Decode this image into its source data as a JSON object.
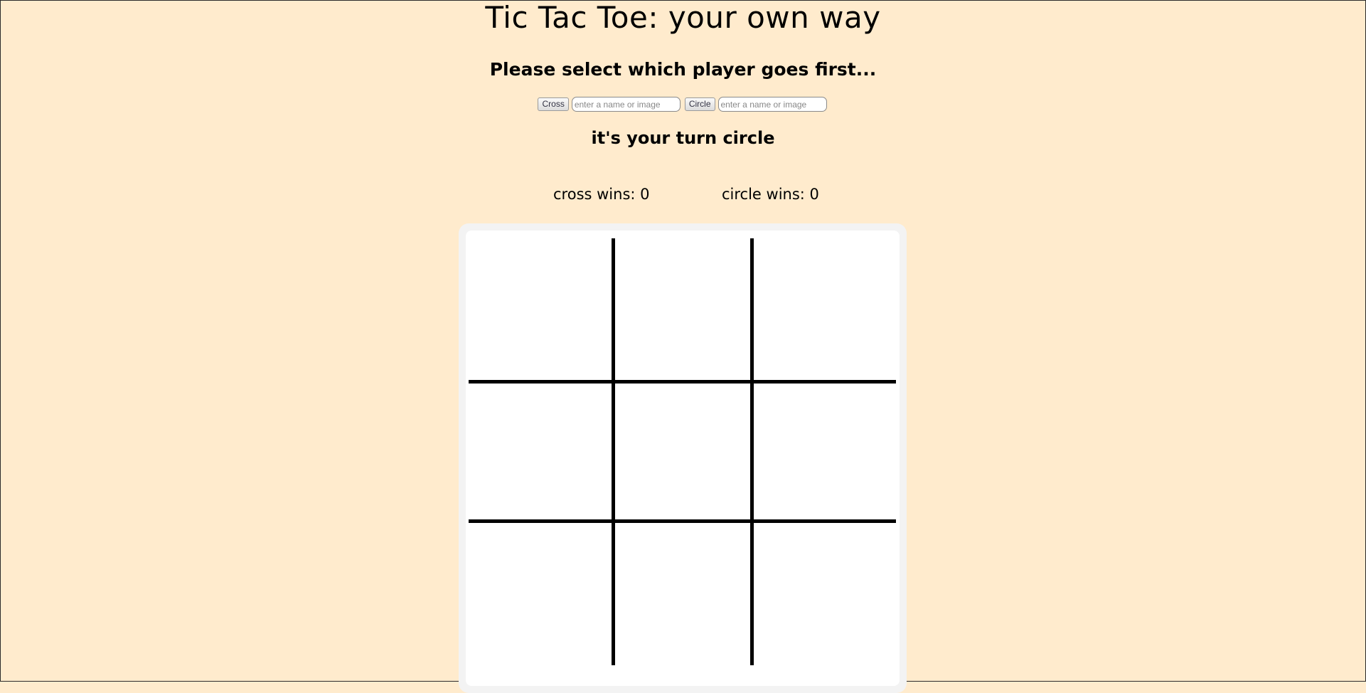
{
  "title": "Tic Tac Toe: your own way",
  "subtitle": "Please select which player goes first...",
  "controls": {
    "cross_button": "Cross",
    "cross_placeholder": "enter a name or image",
    "circle_button": "Circle",
    "circle_placeholder": "enter a name or image"
  },
  "turn_message": "it's your turn circle",
  "scores": {
    "cross": "cross wins: 0",
    "circle": "circle wins: 0"
  },
  "board": {
    "cells": [
      "",
      "",
      "",
      "",
      "",
      "",
      "",
      "",
      ""
    ]
  },
  "colors": {
    "background": "#ffebcd",
    "board_frame": "#f3f3f3",
    "board_surface": "#ffffff",
    "grid_lines": "#000000"
  }
}
